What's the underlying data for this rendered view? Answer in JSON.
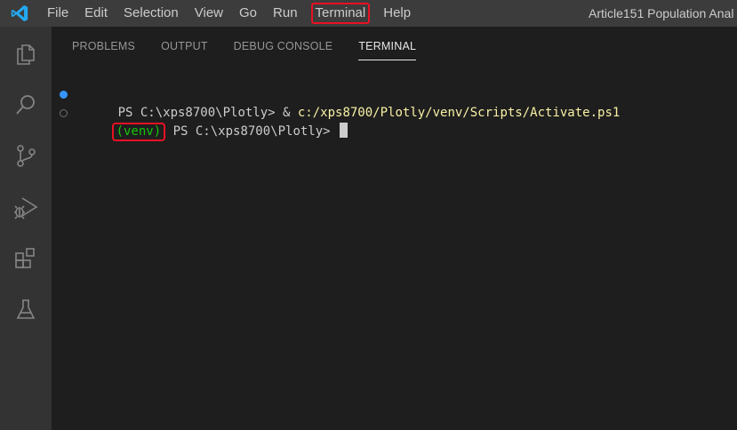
{
  "titlebar": {
    "menu": [
      "File",
      "Edit",
      "Selection",
      "View",
      "Go",
      "Run",
      "Terminal",
      "Help"
    ],
    "window_title": "Article151 Population Anal"
  },
  "activitybar": {
    "icons": [
      "explorer-icon",
      "search-icon",
      "source-control-icon",
      "run-debug-icon",
      "extensions-icon",
      "testing-icon"
    ]
  },
  "panel": {
    "tabs": [
      "PROBLEMS",
      "OUTPUT",
      "DEBUG CONSOLE",
      "TERMINAL"
    ],
    "active_tab": "TERMINAL"
  },
  "terminal": {
    "line1": {
      "prompt": "PS C:\\xps8700\\Plotly> ",
      "operator": "& ",
      "command": "c:/xps8700/Plotly/venv/Scripts/Activate.ps1"
    },
    "line2": {
      "venv": "(venv)",
      "prompt": " PS C:\\xps8700\\Plotly> "
    }
  },
  "colors": {
    "accent": "#007acc",
    "highlight_box": "#e81123",
    "command_yellow": "#f9f1a5",
    "venv_green": "#16c60c"
  }
}
